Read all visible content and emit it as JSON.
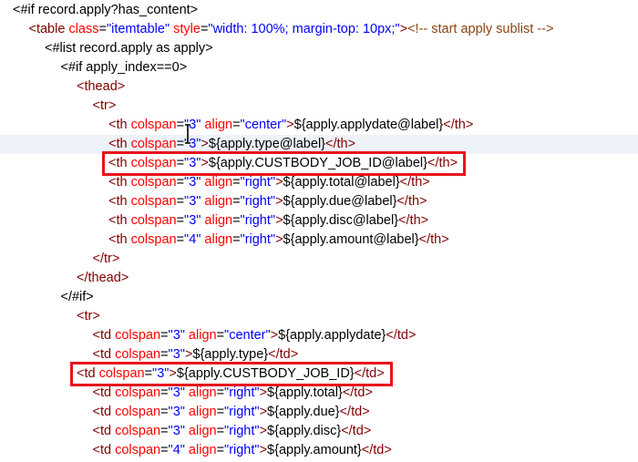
{
  "editor": {
    "lines": [
      {
        "indent": 0,
        "current": false,
        "parts": [
          {
            "t": "txt",
            "v": "<#if record.apply?has_content>"
          }
        ]
      },
      {
        "indent": 1,
        "current": false,
        "parts": [
          {
            "t": "tag",
            "v": "<table "
          },
          {
            "t": "attr",
            "v": "class"
          },
          {
            "t": "txt",
            "v": "="
          },
          {
            "t": "val",
            "v": "\"itemtable\""
          },
          {
            "t": "attr",
            "v": " style"
          },
          {
            "t": "txt",
            "v": "="
          },
          {
            "t": "val",
            "v": "\"width: 100%; margin-top: 10px;\""
          },
          {
            "t": "tag",
            "v": ">"
          },
          {
            "t": "cmt",
            "v": "<!-- start apply sublist -->"
          }
        ]
      },
      {
        "indent": 2,
        "current": false,
        "parts": [
          {
            "t": "txt",
            "v": "<#list record.apply as apply>"
          }
        ]
      },
      {
        "indent": 3,
        "current": false,
        "parts": [
          {
            "t": "txt",
            "v": "<#if apply_index==0>"
          }
        ]
      },
      {
        "indent": 4,
        "current": false,
        "parts": [
          {
            "t": "tag",
            "v": "<thead>"
          }
        ]
      },
      {
        "indent": 5,
        "current": false,
        "parts": [
          {
            "t": "tag",
            "v": "<tr>"
          }
        ]
      },
      {
        "indent": 6,
        "current": false,
        "parts": [
          {
            "t": "tag",
            "v": "<th "
          },
          {
            "t": "attr",
            "v": "colspan"
          },
          {
            "t": "txt",
            "v": "="
          },
          {
            "t": "val",
            "v": "\"3\""
          },
          {
            "t": "attr",
            "v": " align"
          },
          {
            "t": "txt",
            "v": "="
          },
          {
            "t": "val",
            "v": "\"center\""
          },
          {
            "t": "tag",
            "v": ">"
          },
          {
            "t": "txt",
            "v": "${apply.applydate@label}"
          },
          {
            "t": "tag",
            "v": "</th>"
          }
        ]
      },
      {
        "indent": 6,
        "current": true,
        "parts": [
          {
            "t": "tag",
            "v": "<th "
          },
          {
            "t": "attr",
            "v": "colspan"
          },
          {
            "t": "txt",
            "v": "="
          },
          {
            "t": "val",
            "v": "\"3\""
          },
          {
            "t": "tag",
            "v": ">"
          },
          {
            "t": "txt",
            "v": "${apply.type@label}"
          },
          {
            "t": "tag",
            "v": "</th>"
          }
        ]
      },
      {
        "indent": 6,
        "current": false,
        "parts": [
          {
            "t": "tag",
            "v": "<th "
          },
          {
            "t": "attr",
            "v": "colspan"
          },
          {
            "t": "txt",
            "v": "="
          },
          {
            "t": "val",
            "v": "\"3\""
          },
          {
            "t": "tag",
            "v": ">"
          },
          {
            "t": "txt",
            "v": "${apply.CUSTBODY_JOB_ID@label}"
          },
          {
            "t": "tag",
            "v": "</th>"
          }
        ]
      },
      {
        "indent": 6,
        "current": false,
        "parts": [
          {
            "t": "tag",
            "v": "<th "
          },
          {
            "t": "attr",
            "v": "colspan"
          },
          {
            "t": "txt",
            "v": "="
          },
          {
            "t": "val",
            "v": "\"3\""
          },
          {
            "t": "attr",
            "v": " align"
          },
          {
            "t": "txt",
            "v": "="
          },
          {
            "t": "val",
            "v": "\"right\""
          },
          {
            "t": "tag",
            "v": ">"
          },
          {
            "t": "txt",
            "v": "${apply.total@label}"
          },
          {
            "t": "tag",
            "v": "</th>"
          }
        ]
      },
      {
        "indent": 6,
        "current": false,
        "parts": [
          {
            "t": "tag",
            "v": "<th "
          },
          {
            "t": "attr",
            "v": "colspan"
          },
          {
            "t": "txt",
            "v": "="
          },
          {
            "t": "val",
            "v": "\"3\""
          },
          {
            "t": "attr",
            "v": " align"
          },
          {
            "t": "txt",
            "v": "="
          },
          {
            "t": "val",
            "v": "\"right\""
          },
          {
            "t": "tag",
            "v": ">"
          },
          {
            "t": "txt",
            "v": "${apply.due@label}"
          },
          {
            "t": "tag",
            "v": "</th>"
          }
        ]
      },
      {
        "indent": 6,
        "current": false,
        "parts": [
          {
            "t": "tag",
            "v": "<th "
          },
          {
            "t": "attr",
            "v": "colspan"
          },
          {
            "t": "txt",
            "v": "="
          },
          {
            "t": "val",
            "v": "\"3\""
          },
          {
            "t": "attr",
            "v": " align"
          },
          {
            "t": "txt",
            "v": "="
          },
          {
            "t": "val",
            "v": "\"right\""
          },
          {
            "t": "tag",
            "v": ">"
          },
          {
            "t": "txt",
            "v": "${apply.disc@label}"
          },
          {
            "t": "tag",
            "v": "</th>"
          }
        ]
      },
      {
        "indent": 6,
        "current": false,
        "parts": [
          {
            "t": "tag",
            "v": "<th "
          },
          {
            "t": "attr",
            "v": "colspan"
          },
          {
            "t": "txt",
            "v": "="
          },
          {
            "t": "val",
            "v": "\"4\""
          },
          {
            "t": "attr",
            "v": " align"
          },
          {
            "t": "txt",
            "v": "="
          },
          {
            "t": "val",
            "v": "\"right\""
          },
          {
            "t": "tag",
            "v": ">"
          },
          {
            "t": "txt",
            "v": "${apply.amount@label}"
          },
          {
            "t": "tag",
            "v": "</th>"
          }
        ]
      },
      {
        "indent": 5,
        "current": false,
        "parts": [
          {
            "t": "tag",
            "v": "</tr>"
          }
        ]
      },
      {
        "indent": 4,
        "current": false,
        "parts": [
          {
            "t": "tag",
            "v": "</thead>"
          }
        ]
      },
      {
        "indent": 3,
        "current": false,
        "parts": [
          {
            "t": "txt",
            "v": "</#if>"
          }
        ]
      },
      {
        "indent": 4,
        "current": false,
        "parts": [
          {
            "t": "tag",
            "v": "<tr>"
          }
        ]
      },
      {
        "indent": 5,
        "current": false,
        "parts": [
          {
            "t": "tag",
            "v": "<td "
          },
          {
            "t": "attr",
            "v": "colspan"
          },
          {
            "t": "txt",
            "v": "="
          },
          {
            "t": "val",
            "v": "\"3\""
          },
          {
            "t": "attr",
            "v": " align"
          },
          {
            "t": "txt",
            "v": "="
          },
          {
            "t": "val",
            "v": "\"center\""
          },
          {
            "t": "tag",
            "v": ">"
          },
          {
            "t": "txt",
            "v": "${apply.applydate}"
          },
          {
            "t": "tag",
            "v": "</td>"
          }
        ]
      },
      {
        "indent": 5,
        "current": false,
        "parts": [
          {
            "t": "tag",
            "v": "<td "
          },
          {
            "t": "attr",
            "v": "colspan"
          },
          {
            "t": "txt",
            "v": "="
          },
          {
            "t": "val",
            "v": "\"3\""
          },
          {
            "t": "tag",
            "v": ">"
          },
          {
            "t": "txt",
            "v": "${apply.type}"
          },
          {
            "t": "tag",
            "v": "</td>"
          }
        ]
      },
      {
        "indent": 4,
        "current": false,
        "parts": [
          {
            "t": "tag",
            "v": "<td "
          },
          {
            "t": "attr",
            "v": "colspan"
          },
          {
            "t": "txt",
            "v": "="
          },
          {
            "t": "val",
            "v": "\"3\""
          },
          {
            "t": "tag",
            "v": ">"
          },
          {
            "t": "txt",
            "v": "${apply.CUSTBODY_JOB_ID}"
          },
          {
            "t": "tag",
            "v": "</td>"
          }
        ]
      },
      {
        "indent": 5,
        "current": false,
        "parts": [
          {
            "t": "tag",
            "v": "<td "
          },
          {
            "t": "attr",
            "v": "colspan"
          },
          {
            "t": "txt",
            "v": "="
          },
          {
            "t": "val",
            "v": "\"3\""
          },
          {
            "t": "attr",
            "v": " align"
          },
          {
            "t": "txt",
            "v": "="
          },
          {
            "t": "val",
            "v": "\"right\""
          },
          {
            "t": "tag",
            "v": ">"
          },
          {
            "t": "txt",
            "v": "${apply.total}"
          },
          {
            "t": "tag",
            "v": "</td>"
          }
        ]
      },
      {
        "indent": 5,
        "current": false,
        "parts": [
          {
            "t": "tag",
            "v": "<td "
          },
          {
            "t": "attr",
            "v": "colspan"
          },
          {
            "t": "txt",
            "v": "="
          },
          {
            "t": "val",
            "v": "\"3\""
          },
          {
            "t": "attr",
            "v": " align"
          },
          {
            "t": "txt",
            "v": "="
          },
          {
            "t": "val",
            "v": "\"right\""
          },
          {
            "t": "tag",
            "v": ">"
          },
          {
            "t": "txt",
            "v": "${apply.due}"
          },
          {
            "t": "tag",
            "v": "</td>"
          }
        ]
      },
      {
        "indent": 5,
        "current": false,
        "parts": [
          {
            "t": "tag",
            "v": "<td "
          },
          {
            "t": "attr",
            "v": "colspan"
          },
          {
            "t": "txt",
            "v": "="
          },
          {
            "t": "val",
            "v": "\"3\""
          },
          {
            "t": "attr",
            "v": " align"
          },
          {
            "t": "txt",
            "v": "="
          },
          {
            "t": "val",
            "v": "\"right\""
          },
          {
            "t": "tag",
            "v": ">"
          },
          {
            "t": "txt",
            "v": "${apply.disc}"
          },
          {
            "t": "tag",
            "v": "</td>"
          }
        ]
      },
      {
        "indent": 5,
        "current": false,
        "parts": [
          {
            "t": "tag",
            "v": "<td "
          },
          {
            "t": "attr",
            "v": "colspan"
          },
          {
            "t": "txt",
            "v": "="
          },
          {
            "t": "val",
            "v": "\"4\""
          },
          {
            "t": "attr",
            "v": " align"
          },
          {
            "t": "txt",
            "v": "="
          },
          {
            "t": "val",
            "v": "\"right\""
          },
          {
            "t": "tag",
            "v": ">"
          },
          {
            "t": "txt",
            "v": "${apply.amount}"
          },
          {
            "t": "tag",
            "v": "</td>"
          }
        ]
      }
    ],
    "highlighted_lines": [
      8,
      19
    ]
  },
  "colors": {
    "tag": "#800000",
    "attribute": "#ff0000",
    "value": "#0000ff",
    "comment": "#8b4513",
    "highlight_box": "#e8141b",
    "current_line": "#eef3fa"
  },
  "icons": {
    "cursor": "text-cursor-icon"
  }
}
